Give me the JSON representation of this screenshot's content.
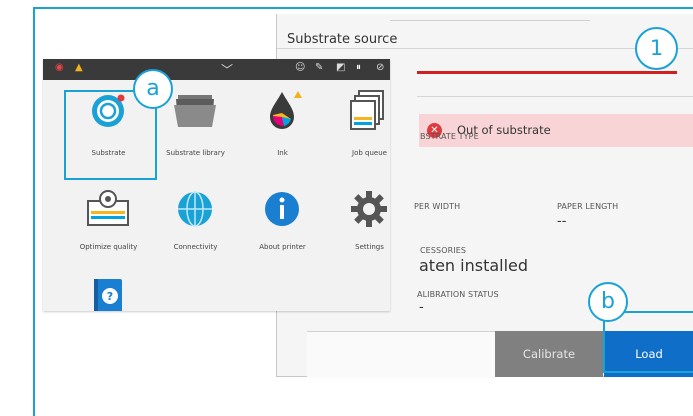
{
  "panel": {
    "title": "Substrate source",
    "alert_text": "Out of substrate",
    "substrate_type_label": "BSTRATE TYPE",
    "paper_width_label": "PER WIDTH",
    "paper_length_label": "PAPER LENGTH",
    "paper_length_value": "--",
    "accessories_label": "CESSORIES",
    "accessories_value": "aten installed",
    "calibration_label": "ALIBRATION STATUS",
    "calibration_value": "-",
    "calibrate_button": "Calibrate",
    "load_button": "Load"
  },
  "home": {
    "tiles": [
      {
        "label": "Substrate",
        "icon": "substrate-roll-icon"
      },
      {
        "label": "Substrate library",
        "icon": "folder-icon"
      },
      {
        "label": "Ink",
        "icon": "ink-drop-icon"
      },
      {
        "label": "Job queue",
        "icon": "job-queue-icon"
      },
      {
        "label": "Optimize quality",
        "icon": "printhead-icon"
      },
      {
        "label": "Connectivity",
        "icon": "globe-icon"
      },
      {
        "label": "About printer",
        "icon": "info-icon"
      },
      {
        "label": "Settings",
        "icon": "gear-icon"
      }
    ]
  },
  "callouts": {
    "one": "1",
    "a": "a",
    "b": "b"
  },
  "colors": {
    "accent": "#1aa2d6",
    "load_button": "#0e6ec8",
    "alert_bg": "#f9d4d6",
    "alert_icon": "#e03a3e",
    "progress_red": "#cf1f1f"
  }
}
